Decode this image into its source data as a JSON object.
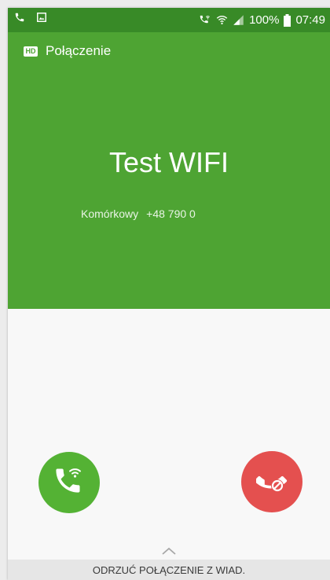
{
  "status_bar": {
    "battery": "100%",
    "time": "07:49",
    "icons": [
      "phone-icon",
      "image-icon",
      "wifi-call-icon",
      "wifi-icon",
      "signal-icon",
      "battery-icon"
    ]
  },
  "call": {
    "hd_badge": "HD",
    "label": "Połączenie",
    "caller_name": "Test WIFI",
    "number_type": "Komórkowy",
    "number": "+48 790 0"
  },
  "actions": {
    "accept_icon": "wifi-phone-icon",
    "decline_icon": "phone-block-icon",
    "reject_with_message": "ODRZUĆ POŁĄCZENIE Z WIAD."
  },
  "colors": {
    "green": "#4ea433",
    "status_green": "#388a27",
    "accept": "#54b234",
    "decline": "#e4504f"
  }
}
